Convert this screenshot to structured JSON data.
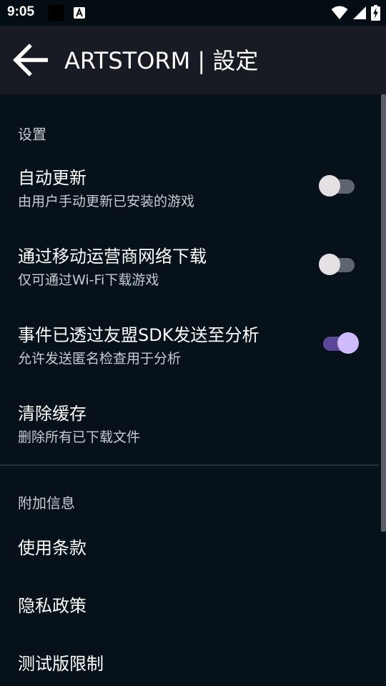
{
  "status_bar": {
    "time": "9:05",
    "icons": [
      "black-square-icon",
      "a-notification-icon",
      "wifi-icon",
      "signal-icon",
      "battery-charging-icon"
    ]
  },
  "app_bar": {
    "back_icon": "arrow-left-icon",
    "title": "ARTSTORM | 設定"
  },
  "settings_section": {
    "header": "设置",
    "items": [
      {
        "title": "自动更新",
        "subtitle": "由用户手动更新已安装的游戏",
        "toggle": false
      },
      {
        "title": "通过移动运营商网络下载",
        "subtitle": "仅可通过Wi-Fi下载游戏",
        "toggle": false
      },
      {
        "title": "事件已透过友盟SDK发送至分析",
        "subtitle": "允许发送匿名检查用于分析",
        "toggle": true
      },
      {
        "title": "清除缓存",
        "subtitle": "删除所有已下载文件"
      }
    ]
  },
  "info_section": {
    "header": "附加信息",
    "items": [
      {
        "label": "使用条款"
      },
      {
        "label": "隐私政策"
      },
      {
        "label": "测试版限制"
      }
    ]
  },
  "colors": {
    "background": "#07111a",
    "app_bar": "#181b24",
    "toggle_on_thumb": "#cfbbff",
    "toggle_on_track": "#5b4798",
    "toggle_off_thumb": "#e4e0e4",
    "toggle_off_track": "#5e6470"
  }
}
